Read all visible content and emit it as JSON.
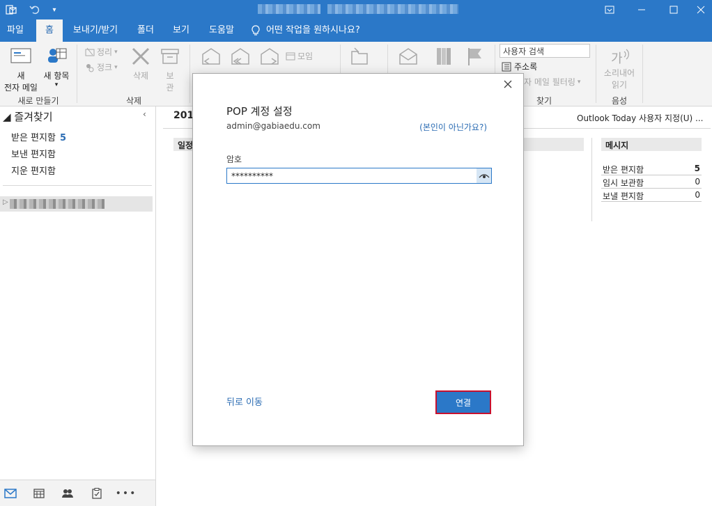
{
  "tabs": [
    {
      "label": "파일"
    },
    {
      "label": "홈"
    },
    {
      "label": "보내기/받기"
    },
    {
      "label": "폴더"
    },
    {
      "label": "보기"
    },
    {
      "label": "도움말"
    }
  ],
  "tell_me": "어떤 작업을 원하시나요?",
  "ribbon": {
    "new_mail": [
      "새",
      "전자 메일"
    ],
    "new_items": "새 항목",
    "group_new": "새로 만들기",
    "cleanup": "정리",
    "junk": "정크",
    "delete": "삭제",
    "archive": [
      "보",
      "관"
    ],
    "group_delete": "삭제",
    "meeting": "모임",
    "search_people": "사용자 검색",
    "address_book": "주소록",
    "filter_mail": "자 메일 필터링",
    "group_find": "찾기",
    "read_aloud": [
      "소리내어",
      "읽기"
    ],
    "group_voice": "음성"
  },
  "nav": {
    "favorites": "즐겨찾기",
    "items": [
      {
        "label": "받은 편지함",
        "count": "5"
      },
      {
        "label": "보낸 편지함",
        "count": ""
      },
      {
        "label": "지운 편지함",
        "count": ""
      }
    ]
  },
  "content": {
    "date_partial": "201",
    "customize": "Outlook Today 사용자 지정(U) ...",
    "schedule_partial": "일정",
    "messages_header": "메시지",
    "messages": [
      {
        "label": "받은 편지함",
        "value": "5"
      },
      {
        "label": "임시 보관함",
        "value": "0"
      },
      {
        "label": "보낼 편지함",
        "value": "0"
      }
    ]
  },
  "dialog": {
    "title": "POP 계정 설정",
    "email": "admin@gabiaedu.com",
    "not_you": "(본인이 아닌가요?)",
    "password_label": "암호",
    "password_value": "**********",
    "back": "뒤로 이동",
    "connect": "연결"
  },
  "colors": {
    "accent": "#2b78c8",
    "link": "#2b6cb3",
    "highlight_border": "#c8102e"
  }
}
